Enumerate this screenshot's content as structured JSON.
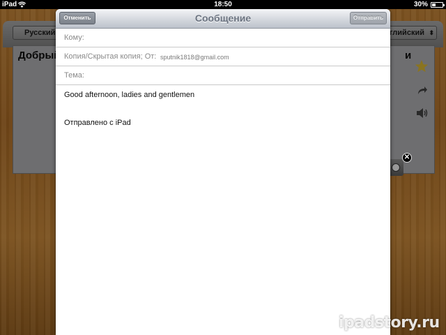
{
  "status_bar": {
    "device": "iPad",
    "time": "18:50",
    "battery": "30%"
  },
  "background_app": {
    "source_language": "Русский",
    "target_language": "глийский",
    "card_title_left": "Добрый",
    "card_title_right": "и",
    "icons": [
      "star-icon",
      "share-icon",
      "speaker-icon",
      "mic-icon",
      "close-icon"
    ]
  },
  "compose": {
    "title": "Сообщение",
    "cancel_label": "Отменить",
    "send_label": "Отправить",
    "to_label": "Кому:",
    "cc_label": "Копия/Скрытая копия; От:",
    "from_value": "sputnik1818@gmail.com",
    "subject_label": "Тема:",
    "body_text": "Good afternoon, ladies and gentlemen",
    "signature": "Отправлено с iPad"
  },
  "watermark": "ipadstory.ru",
  "colors": {
    "wood": "#6d4417",
    "navbar": "#d4d8de",
    "cancel_button": "#7b818a",
    "send_button_disabled": "#9ea3aa"
  }
}
